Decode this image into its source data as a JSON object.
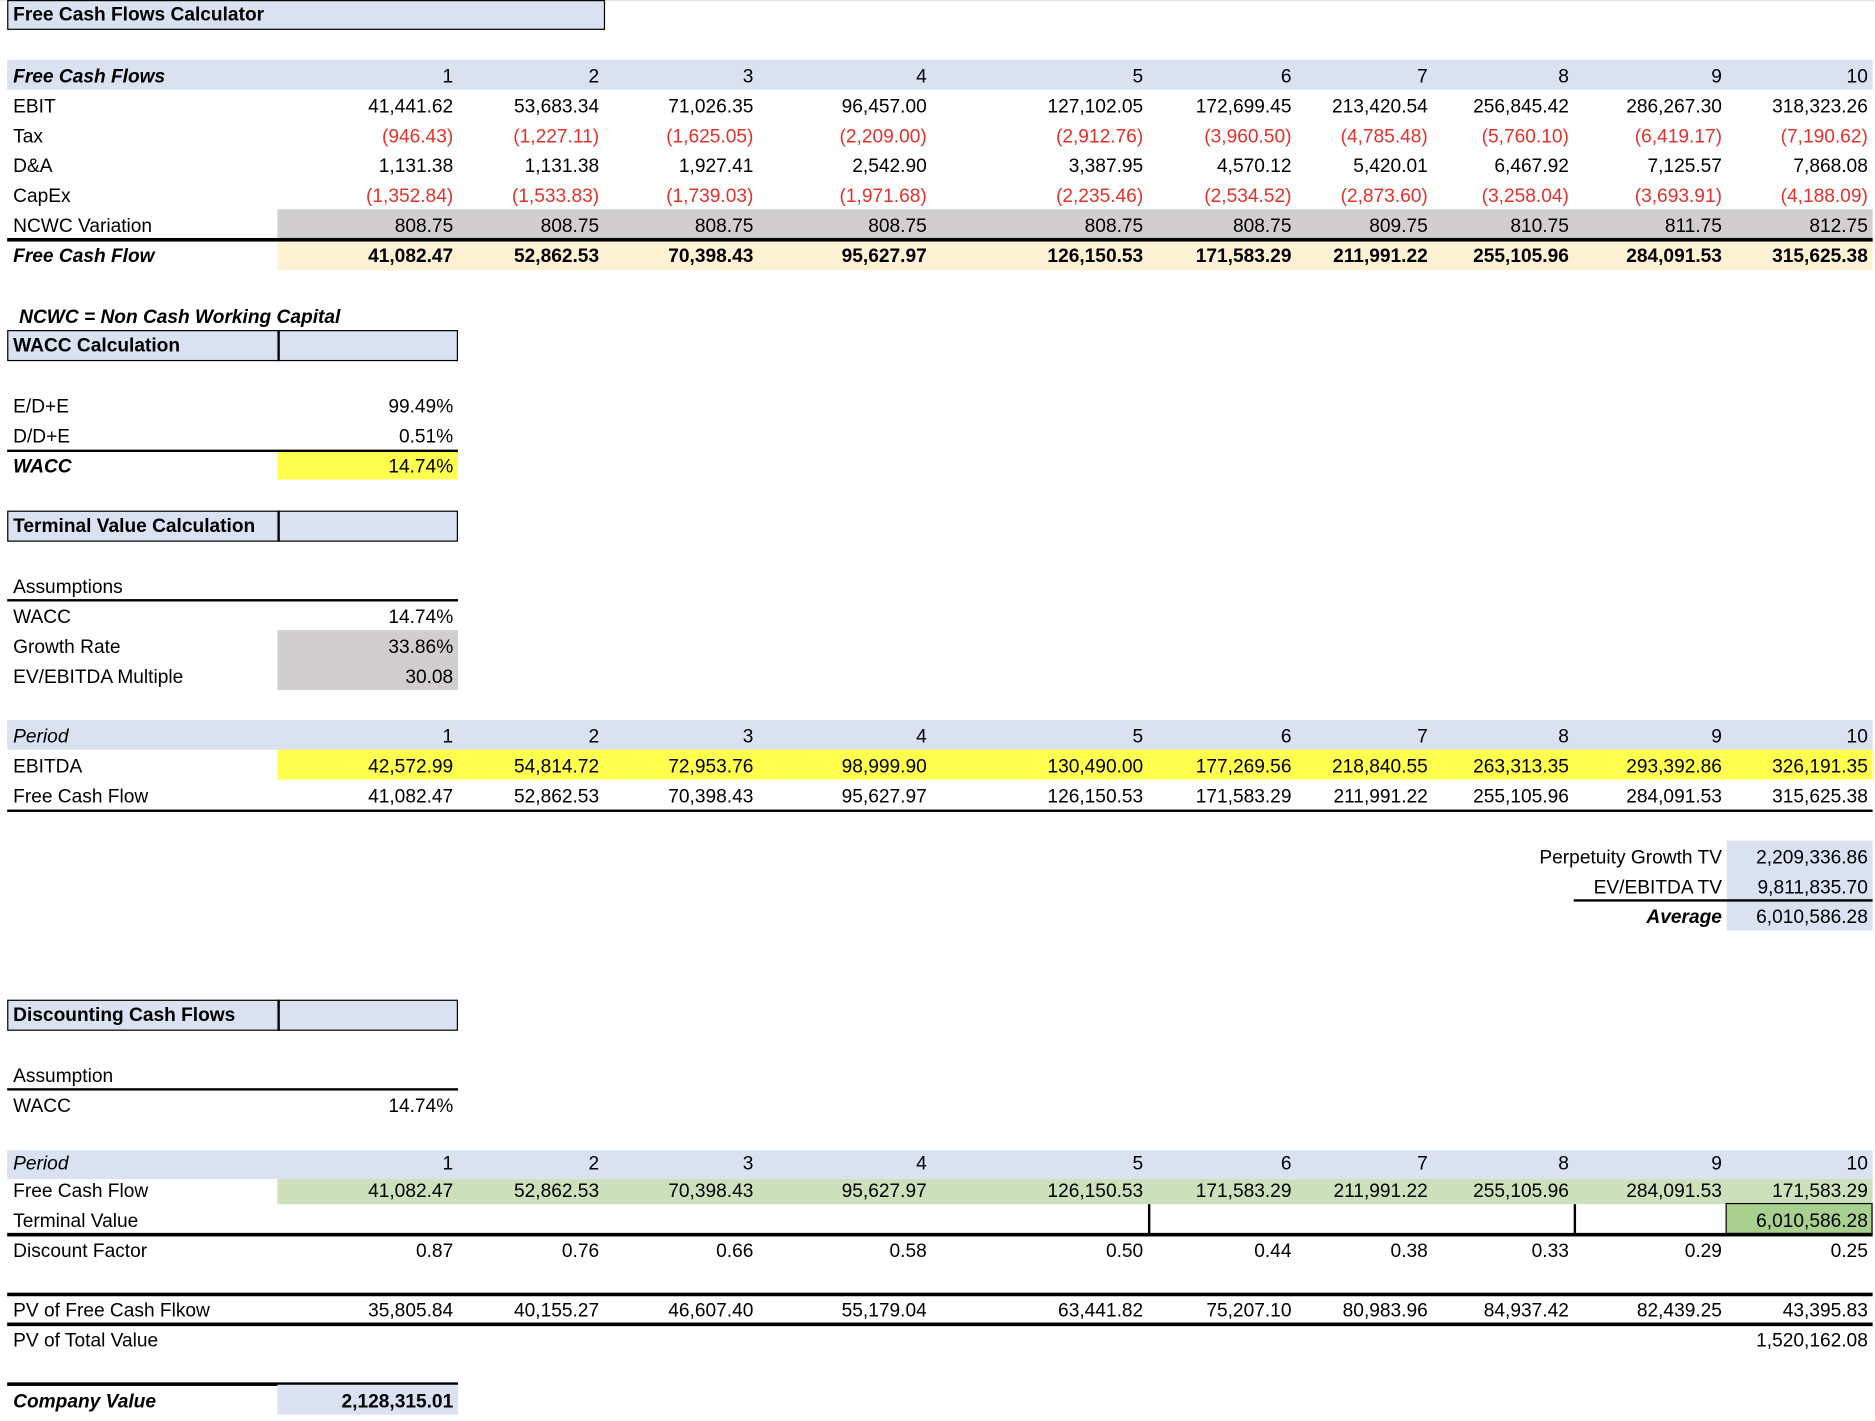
{
  "title": "Free Cash Flows Calculator",
  "periods": [
    "1",
    "2",
    "3",
    "4",
    "5",
    "6",
    "7",
    "8",
    "9",
    "10"
  ],
  "colors": {
    "header_blue": "#dae1f0",
    "grey": "#d0cece",
    "cream": "#fdf1d3",
    "yellow": "#ffff4d",
    "green": "#cde0bc",
    "green_dark": "#a9d08e",
    "negative": "#e8302a"
  },
  "fcf": {
    "header": "Free Cash Flows",
    "rows": [
      {
        "label": "EBIT",
        "values": [
          "41,441.62",
          "53,683.34",
          "71,026.35",
          "96,457.00",
          "127,102.05",
          "172,699.45",
          "213,420.54",
          "256,845.42",
          "286,267.30",
          "318,323.26"
        ]
      },
      {
        "label": "Tax",
        "values": [
          "(946.43)",
          "(1,227.11)",
          "(1,625.05)",
          "(2,209.00)",
          "(2,912.76)",
          "(3,960.50)",
          "(4,785.48)",
          "(5,760.10)",
          "(6,419.17)",
          "(7,190.62)"
        ]
      },
      {
        "label": "D&A",
        "values": [
          "1,131.38",
          "1,131.38",
          "1,927.41",
          "2,542.90",
          "3,387.95",
          "4,570.12",
          "5,420.01",
          "6,467.92",
          "7,125.57",
          "7,868.08"
        ]
      },
      {
        "label": "CapEx",
        "values": [
          "(1,352.84)",
          "(1,533.83)",
          "(1,739.03)",
          "(1,971.68)",
          "(2,235.46)",
          "(2,534.52)",
          "(2,873.60)",
          "(3,258.04)",
          "(3,693.91)",
          "(4,188.09)"
        ]
      },
      {
        "label": "NCWC Variation",
        "values": [
          "808.75",
          "808.75",
          "808.75",
          "808.75",
          "808.75",
          "808.75",
          "809.75",
          "810.75",
          "811.75",
          "812.75"
        ]
      },
      {
        "label": "Free Cash Flow",
        "values": [
          "41,082.47",
          "52,862.53",
          "70,398.43",
          "95,627.97",
          "126,150.53",
          "171,583.29",
          "211,991.22",
          "255,105.96",
          "284,091.53",
          "315,625.38"
        ]
      }
    ],
    "note": "NCWC = Non Cash Working Capital"
  },
  "wacc": {
    "header": "WACC Calculation",
    "rows": [
      {
        "label": "E/D+E",
        "value": "99.49%"
      },
      {
        "label": "D/D+E",
        "value": "0.51%"
      },
      {
        "label": "WACC",
        "value": "14.74%"
      }
    ]
  },
  "terminal": {
    "header": "Terminal Value Calculation",
    "assumptions_label": "Assumptions",
    "rows": [
      {
        "label": "WACC",
        "value": "14.74%"
      },
      {
        "label": "Growth Rate",
        "value": "33.86%"
      },
      {
        "label": "EV/EBITDA Multiple",
        "value": "30.08"
      }
    ],
    "period_label": "Period",
    "ebitda": {
      "label": "EBITDA",
      "values": [
        "42,572.99",
        "54,814.72",
        "72,953.76",
        "98,999.90",
        "130,490.00",
        "177,269.56",
        "218,840.55",
        "263,313.35",
        "293,392.86",
        "326,191.35"
      ]
    },
    "fcf": {
      "label": "Free Cash Flow",
      "values": [
        "41,082.47",
        "52,862.53",
        "70,398.43",
        "95,627.97",
        "126,150.53",
        "171,583.29",
        "211,991.22",
        "255,105.96",
        "284,091.53",
        "315,625.38"
      ]
    },
    "results": [
      {
        "label": "Perpetuity Growth TV",
        "value": "2,209,336.86"
      },
      {
        "label": "EV/EBITDA TV",
        "value": "9,811,835.70"
      },
      {
        "label": "Average",
        "value": "6,010,586.28"
      }
    ]
  },
  "discount": {
    "header": "Discounting Cash Flows",
    "assumption_label": "Assumption",
    "wacc": {
      "label": "WACC",
      "value": "14.74%"
    },
    "period_label": "Period",
    "fcf": {
      "label": "Free Cash Flow",
      "values": [
        "41,082.47",
        "52,862.53",
        "70,398.43",
        "95,627.97",
        "126,150.53",
        "171,583.29",
        "211,991.22",
        "255,105.96",
        "284,091.53",
        "171,583.29"
      ]
    },
    "terminal": {
      "label": "Terminal Value",
      "value": "6,010,586.28"
    },
    "factor": {
      "label": "Discount Factor",
      "values": [
        "0.87",
        "0.76",
        "0.66",
        "0.58",
        "0.50",
        "0.44",
        "0.38",
        "0.33",
        "0.29",
        "0.25"
      ]
    },
    "pv_fcf": {
      "label": "PV of Free Cash Flkow",
      "values": [
        "35,805.84",
        "40,155.27",
        "46,607.40",
        "55,179.04",
        "63,441.82",
        "75,207.10",
        "80,983.96",
        "84,937.42",
        "82,439.25",
        "43,395.83"
      ]
    },
    "pv_total": {
      "label": "PV of Total Value",
      "value": "1,520,162.08"
    },
    "company": {
      "label": "Company Value",
      "value": "2,128,315.01"
    }
  }
}
